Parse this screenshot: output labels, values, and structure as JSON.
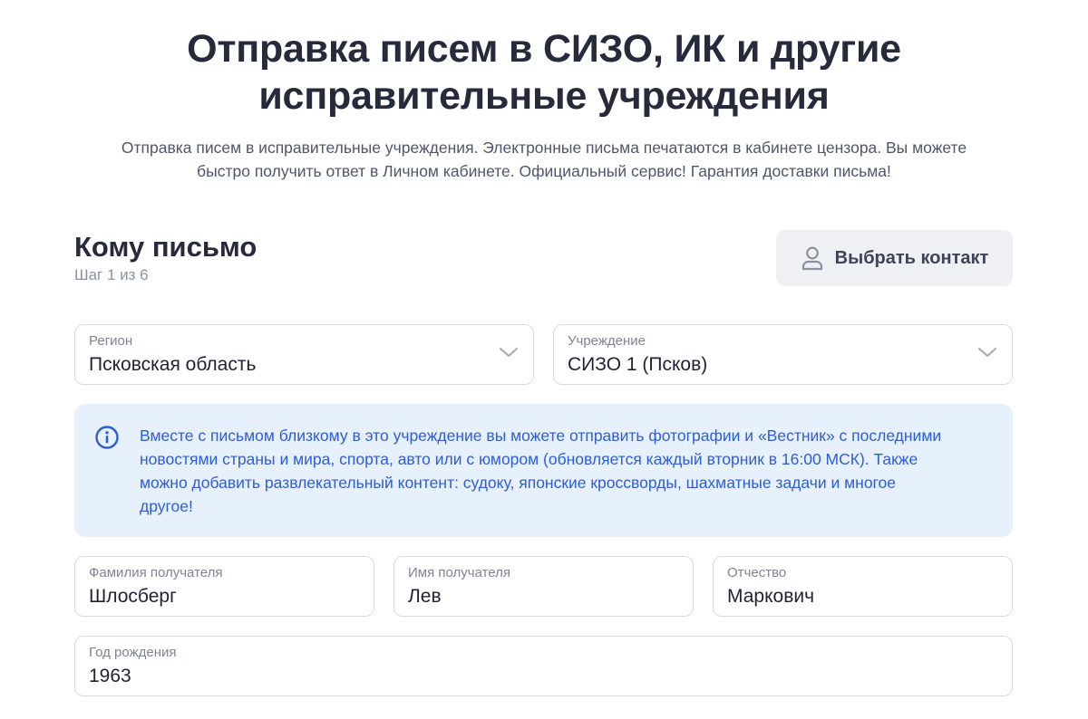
{
  "hero": {
    "title_line1": "Отправка писем в СИЗО, ИК и другие",
    "title_line2": "исправительные учреждения",
    "subtitle_line1": "Отправка писем в исправительные учреждения. Электронные письма печатаются в кабинете цензора. Вы можете",
    "subtitle_line2": "быстро получить ответ в Личном кабинете. Официальный сервис! Гарантия доставки письма!"
  },
  "form": {
    "section_title": "Кому письмо",
    "step_label": "Шаг 1 из 6",
    "contact_button_label": "Выбрать контакт",
    "contact_button_icon": "user-icon",
    "region": {
      "label": "Регион",
      "value": "Псковская область"
    },
    "institution": {
      "label": "Учреждение",
      "value": "СИЗО 1 (Псков)"
    },
    "info": {
      "icon": "info-icon",
      "line1": "Вместе с письмом близкому в это учреждение вы можете отправить фотографии и «Вестник» с последними",
      "line2": "новостями страны и мира, спорта, авто или с юмором (обновляется каждый вторник в 16:00 МСК). Также",
      "line3": "можно добавить развлекательный контент: судоку, японские кроссворды, шахматные задачи и многое",
      "line4": "другое!"
    },
    "last_name": {
      "label": "Фамилия получателя",
      "value": "Шлосберг"
    },
    "first_name": {
      "label": "Имя получателя",
      "value": "Лев"
    },
    "patronymic": {
      "label": "Отчество",
      "value": "Маркович"
    },
    "birth_year": {
      "label": "Год рождения",
      "value": "1963"
    }
  },
  "colors": {
    "heading": "#262a3b",
    "muted": "#8d92a3",
    "info_bg": "#e7f0fd",
    "info_text": "#2e5ed6",
    "button_bg": "#eff0f3",
    "field_border": "#d8dbe2"
  }
}
